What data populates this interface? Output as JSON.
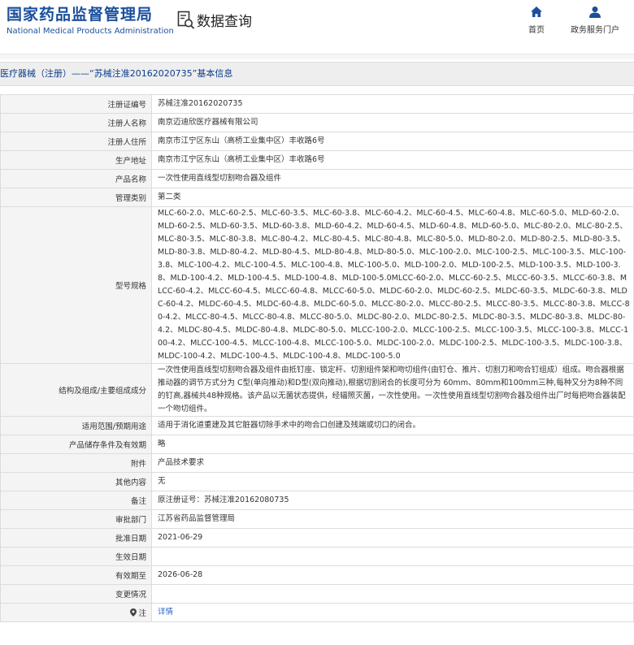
{
  "header": {
    "logo_cn": "国家药品监督管理局",
    "logo_en": "National Medical Products Administration",
    "section_title": "数据查询",
    "nav": [
      {
        "label": "首页",
        "icon": "home-icon"
      },
      {
        "label": "政务服务门户",
        "icon": "user-icon"
      }
    ],
    "accent_color": "#1a4f9c"
  },
  "page_title": "医疗器械（注册）——“苏械注准20162020735”基本信息",
  "rows": [
    {
      "label": "注册证编号",
      "value": "苏械注准20162020735"
    },
    {
      "label": "注册人名称",
      "value": "南京迈迪欣医疗器械有限公司"
    },
    {
      "label": "注册人住所",
      "value": "南京市江宁区东山（高桥工业集中区）丰收路6号"
    },
    {
      "label": "生产地址",
      "value": "南京市江宁区东山（高桥工业集中区）丰收路6号"
    },
    {
      "label": "产品名称",
      "value": "一次性使用直线型切割吻合器及组件"
    },
    {
      "label": "管理类别",
      "value": "第二类"
    },
    {
      "label": "型号规格",
      "value": "MLC-60-2.0、MLC-60-2.5、MLC-60-3.5、MLC-60-3.8、MLC-60-4.2、MLC-60-4.5、MLC-60-4.8、MLC-60-5.0、MLD-60-2.0、MLD-60-2.5、MLD-60-3.5、MLD-60-3.8、MLD-60-4.2、MLD-60-4.5、MLD-60-4.8、MLD-60-5.0、MLC-80-2.0、MLC-80-2.5、MLC-80-3.5、MLC-80-3.8、MLC-80-4.2、MLC-80-4.5、MLC-80-4.8、MLC-80-5.0、MLD-80-2.0、MLD-80-2.5、MLD-80-3.5、MLD-80-3.8、MLD-80-4.2、MLD-80-4.5、MLD-80-4.8、MLD-80-5.0、MLC-100-2.0、MLC-100-2.5、MLC-100-3.5、MLC-100-3.8、MLC-100-4.2、MLC-100-4.5、MLC-100-4.8、MLC-100-5.0、MLD-100-2.0、MLD-100-2.5、MLD-100-3.5、MLD-100-3.8、MLD-100-4.2、MLD-100-4.5、MLD-100-4.8、MLD-100-5.0MLCC-60-2.0、MLCC-60-2.5、MLCC-60-3.5、MLCC-60-3.8、MLCC-60-4.2、MLCC-60-4.5、MLCC-60-4.8、MLCC-60-5.0、MLDC-60-2.0、MLDC-60-2.5、MLDC-60-3.5、MLDC-60-3.8、MLDC-60-4.2、MLDC-60-4.5、MLDC-60-4.8、MLDC-60-5.0、MLCC-80-2.0、MLCC-80-2.5、MLCC-80-3.5、MLCC-80-3.8、MLCC-80-4.2、MLCC-80-4.5、MLCC-80-4.8、MLCC-80-5.0、MLDC-80-2.0、MLDC-80-2.5、MLDC-80-3.5、MLDC-80-3.8、MLDC-80-4.2、MLDC-80-4.5、MLDC-80-4.8、MLDC-80-5.0、MLCC-100-2.0、MLCC-100-2.5、MLCC-100-3.5、MLCC-100-3.8、MLCC-100-4.2、MLCC-100-4.5、MLCC-100-4.8、MLCC-100-5.0、MLDC-100-2.0、MLDC-100-2.5、MLDC-100-3.5、MLDC-100-3.8、MLDC-100-4.2、MLDC-100-4.5、MLDC-100-4.8、MLDC-100-5.0"
    },
    {
      "label": "结构及组成/主要组成成分",
      "value": "一次性使用直线型切割吻合器及组件由抵钉座、锁定杆、切割组件架和吻切组件(由钉仓、推片、切割刀和吻合钉组成）组成。吻合器根据推动器的调节方式分为 C型(单向推动)和D型(双向推动),根据切割闭合的长度可分为 60mm、80mm和100mm三种,每种又分为8种不同的钉高,器械共48种规格。该产品以无菌状态提供，经辐照灭菌，一次性使用。一次性使用直线型切割吻合器及组件出厂时每把吻合器装配一个吻切组件。"
    },
    {
      "label": "适用范围/预期用途",
      "value": "适用于消化道重建及其它脏器切除手术中的吻合口创建及残端或切口的闭合。"
    },
    {
      "label": "产品储存条件及有效期",
      "value": "略"
    },
    {
      "label": "附件",
      "value": "产品技术要求"
    },
    {
      "label": "其他内容",
      "value": "无"
    },
    {
      "label": "备注",
      "value": "原注册证号：苏械注准20162080735"
    },
    {
      "label": "审批部门",
      "value": "江苏省药品监督管理局"
    },
    {
      "label": "批准日期",
      "value": "2021-06-29"
    },
    {
      "label": "生效日期",
      "value": ""
    },
    {
      "label": "有效期至",
      "value": "2026-06-28"
    },
    {
      "label": "变更情况",
      "value": ""
    },
    {
      "label": "注",
      "value": "详情",
      "link": true,
      "icon": "pin-icon"
    }
  ]
}
